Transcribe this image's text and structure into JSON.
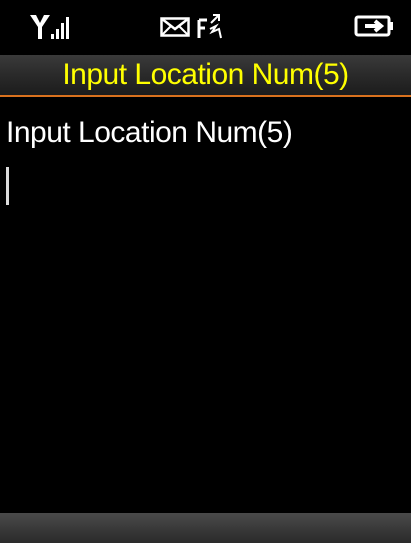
{
  "status_bar": {
    "icons": [
      "signal-strength-icon",
      "message-envelope-icon",
      "call-forward-icon",
      "battery-charging-icon"
    ]
  },
  "header": {
    "title": "Input Location Num(5)"
  },
  "main": {
    "prompt": "Input Location Num(5)"
  },
  "colors": {
    "background": "#000000",
    "title_text": "#ffff00",
    "content_text": "#ffffff",
    "accent_line": "#d9711e"
  }
}
